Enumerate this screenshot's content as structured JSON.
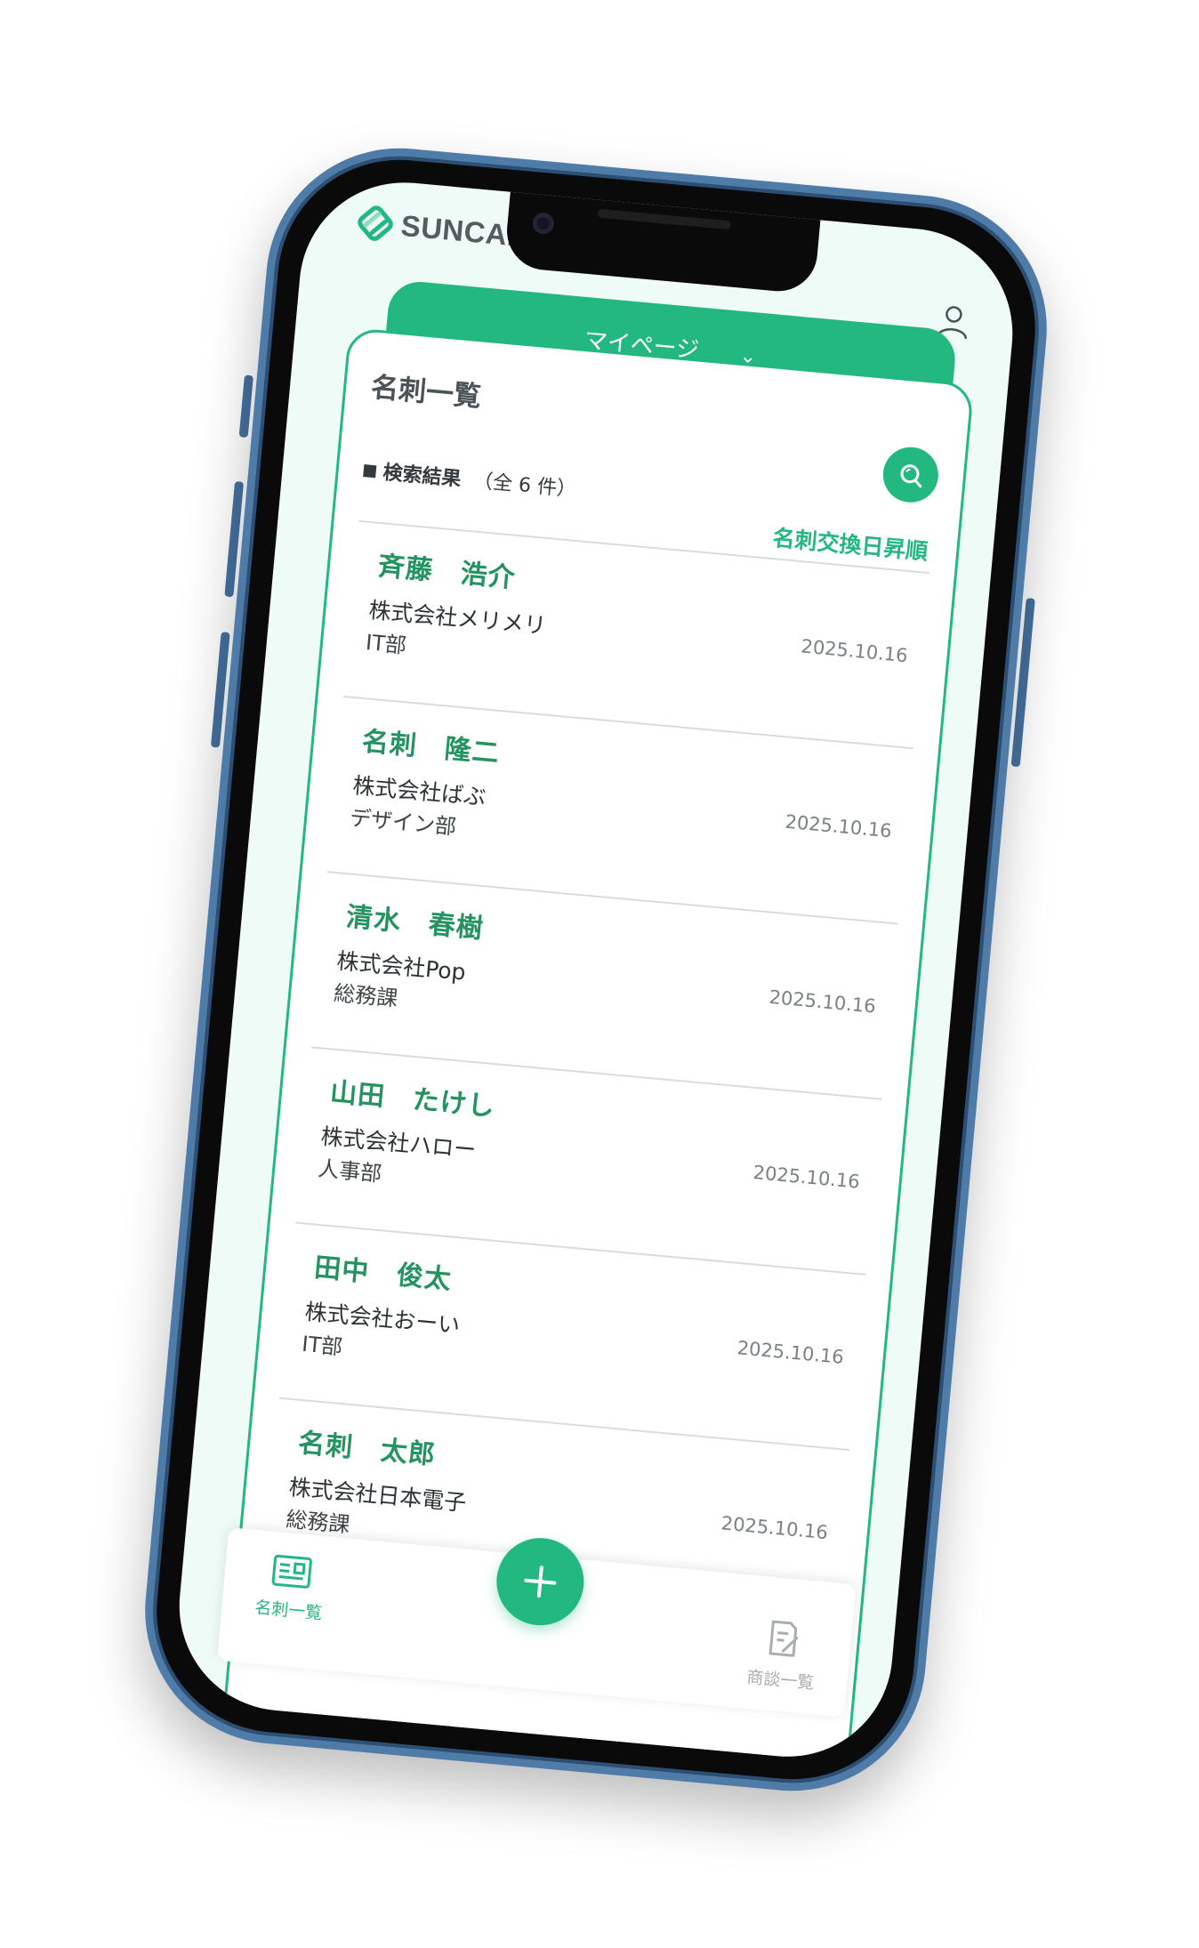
{
  "app": {
    "brand": "SUNCARD",
    "accent_color": "#23b880"
  },
  "header": {
    "menu_label": "マイページ",
    "menu_icon": "chevron-down-icon",
    "profile_icon": "user-icon"
  },
  "page": {
    "title": "名刺一覧",
    "result_label": "検索結果",
    "result_count": "（全 6 件）",
    "sort_label": "名刺交換日昇順",
    "search_icon": "search-icon"
  },
  "cards": [
    {
      "name": "斉藤　浩介",
      "company": "株式会社メリメリ",
      "department": "IT部",
      "date": "2025.10.16"
    },
    {
      "name": "名刺　隆二",
      "company": "株式会社ばぶ",
      "department": "デザイン部",
      "date": "2025.10.16"
    },
    {
      "name": "清水　春樹",
      "company": "株式会社Pop",
      "department": "総務課",
      "date": "2025.10.16"
    },
    {
      "name": "山田　たけし",
      "company": "株式会社ハロー",
      "department": "人事部",
      "date": "2025.10.16"
    },
    {
      "name": "田中　俊太",
      "company": "株式会社おーい",
      "department": "IT部",
      "date": "2025.10.16"
    },
    {
      "name": "名刺　太郎",
      "company": "株式会社日本電子",
      "department": "総務課",
      "date": "2025.10.16"
    }
  ],
  "bottom_nav": {
    "left_label": "名刺一覧",
    "left_icon": "business-card-icon",
    "right_label": "商談一覧",
    "right_icon": "memo-edit-icon",
    "center_icon": "plus-icon"
  }
}
